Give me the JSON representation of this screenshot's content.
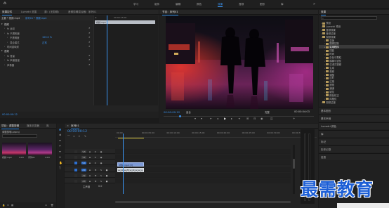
{
  "colors": {
    "accent": "#2d8ceb",
    "timecode": "#3a93f0",
    "clip_video": "#7d9ad6",
    "clip_audio": "#b9c0c8",
    "playhead": "#3a93f0",
    "render_bar": "#d8c640"
  },
  "top_bar": {
    "home_icon": "home-icon",
    "workspaces": [
      "学习",
      "组件",
      "编辑",
      "颜色",
      "效果",
      "音频",
      "图形",
      "库"
    ],
    "active_workspace": "效果",
    "overflow": "»"
  },
  "effect_controls": {
    "tabs": [
      "效果控件",
      "Lumetri 范围",
      "源：(无剪辑)",
      "音频剪辑混合器：序列01"
    ],
    "source_label": "主要 * 视频.mp4",
    "seq_label": "序列01 * 视频.mp4",
    "timecode_header": "00:00:15:00",
    "clip_label": "视频.mp4",
    "rows": [
      {
        "label": "视频",
        "indent": 0
      },
      {
        "label": "fx 运动",
        "indent": 1
      },
      {
        "label": "fx 不透明度",
        "indent": 1
      },
      {
        "label": "不透明度",
        "value": "100.0 %",
        "indent": 2
      },
      {
        "label": "混合模式",
        "value": "正常",
        "indent": 2
      },
      {
        "label": "时间重映射",
        "indent": 1
      },
      {
        "label": "音频",
        "indent": 0
      },
      {
        "label": "fx 音量",
        "indent": 1
      },
      {
        "label": "fx 声道音量",
        "indent": 1
      },
      {
        "label": "声像器",
        "indent": 1
      }
    ],
    "footer_timecode": "00:00:00:12"
  },
  "program_monitor": {
    "title": "节目：序列01",
    "timecode": "00:00:00:12",
    "fit": "适合",
    "quality": "完整",
    "duration": "00:00:04:03"
  },
  "effects_panel": {
    "title": "效果",
    "items": [
      {
        "label": "预设",
        "indent": 0
      },
      {
        "label": "Lumetri 预设",
        "indent": 0
      },
      {
        "label": "音频效果",
        "indent": 0
      },
      {
        "label": "音频过渡",
        "indent": 0
      },
      {
        "label": "视频效果",
        "indent": 0
      },
      {
        "label": "变换",
        "indent": 1
      },
      {
        "label": "图像控制",
        "indent": 1
      },
      {
        "label": "实用程序",
        "indent": 1
      },
      {
        "label": "扭曲",
        "indent": 1
      },
      {
        "label": "时间",
        "indent": 1
      },
      {
        "label": "杂色与颗粒",
        "indent": 1
      },
      {
        "label": "模糊与锐化",
        "indent": 1
      },
      {
        "label": "沉浸式视频",
        "indent": 1
      },
      {
        "label": "生成",
        "indent": 1
      },
      {
        "label": "视频",
        "indent": 1
      },
      {
        "label": "调整",
        "indent": 1
      },
      {
        "label": "过时",
        "indent": 1
      },
      {
        "label": "过渡",
        "indent": 1
      },
      {
        "label": "透视",
        "indent": 1
      },
      {
        "label": "通道",
        "indent": 1
      },
      {
        "label": "键控",
        "indent": 1
      },
      {
        "label": "颜色校正",
        "indent": 1
      },
      {
        "label": "风格化",
        "indent": 1
      },
      {
        "label": "视频过渡",
        "indent": 0
      }
    ],
    "selected_index": 7,
    "bottom_panels": [
      "基本图形",
      "基本声音",
      "Lumetri 颜色",
      "库",
      "标记",
      "历史记录",
      "信息"
    ]
  },
  "project_panel": {
    "tabs": [
      "项目：调整剪辑",
      "媒体浏览器",
      "库"
    ],
    "project_file": "调整剪辑.prproj",
    "items": [
      {
        "name": "视频.mp4",
        "duration": "4:03"
      },
      {
        "name": "序列01",
        "duration": "4:03"
      }
    ]
  },
  "timeline": {
    "tabs": [
      "×",
      "序列01"
    ],
    "timecode": "00:00:00:12",
    "ruler": [
      "00:00",
      "00:00:05:00",
      "00:00:10:00",
      "00:00:15:00",
      "00:00:20:00",
      "00:00:25:00",
      "00:00:30:00",
      "00:00:35:00"
    ],
    "tracks": [
      {
        "name": "V3"
      },
      {
        "name": "V2"
      },
      {
        "name": "V1",
        "clip": "视频.mp4 [V]"
      },
      {
        "name": "A1",
        "clip": ""
      },
      {
        "name": "A2"
      },
      {
        "name": "A3"
      }
    ],
    "master": "主声道",
    "master_value": "0.0"
  },
  "tools": [
    "selection-tool",
    "track-select-tool",
    "ripple-edit-tool",
    "razor-tool",
    "slip-tool",
    "pen-tool",
    "hand-tool",
    "type-tool"
  ],
  "watermark": {
    "text": "最需教育"
  }
}
